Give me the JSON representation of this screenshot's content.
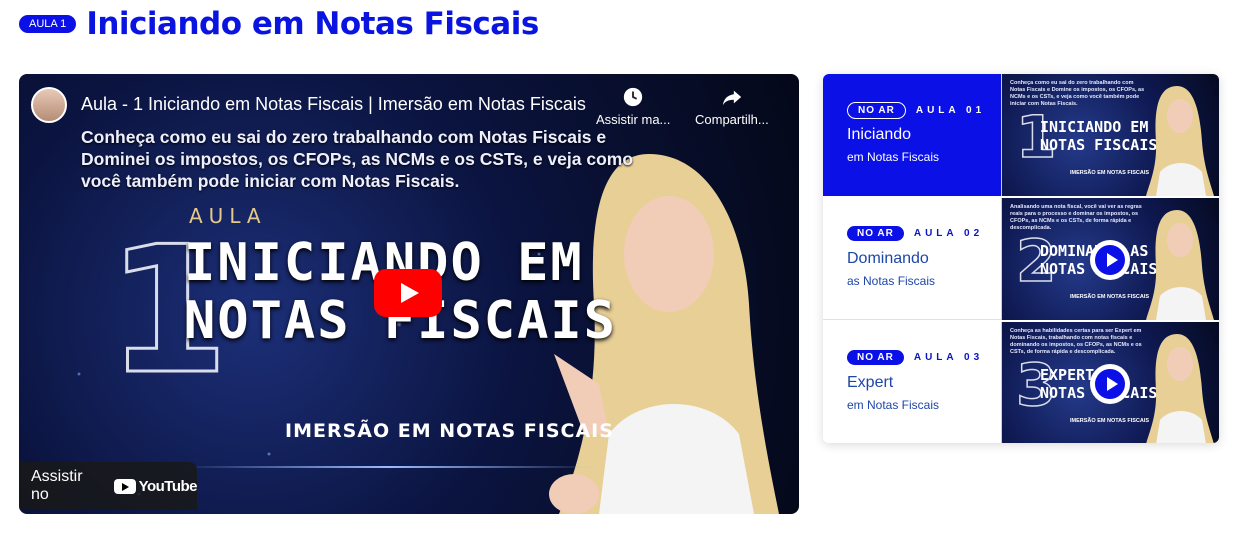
{
  "header": {
    "badge": "AULA 1",
    "title": "Iniciando em Notas Fiscais"
  },
  "player": {
    "video_title": "Aula - 1 Iniciando em Notas Fiscais | Imersão em Notas Fiscais",
    "watch_later_label": "Assistir ma...",
    "share_label": "Compartilh...",
    "description": "Conheça como eu sai do zero trabalhando com Notas Fiscais e Dominei os impostos, os CFOPs, as NCMs e os CSTs, e veja como você também pode iniciar com Notas Fiscais.",
    "thumb_number": "1",
    "thumb_aula": "AULA",
    "thumb_title_line1": "INICIANDO EM",
    "thumb_title_line2": "NOTAS FISCAIS",
    "thumb_footer": "IMERSÃO EM NOTAS FISCAIS",
    "watch_on": "Assistir no",
    "youtube": "YouTube"
  },
  "playlist": [
    {
      "tag": "NO AR",
      "aula": "AULA 01",
      "title": "Iniciando",
      "subtitle": "em Notas Fiscais",
      "thumb_desc": "Conheça como eu sai do zero trabalhando com Notas Fiscais e Domine os impostos, os CFOPs, as NCMs e os CSTs, e veja como você também pode iniciar com Notas Fiscais.",
      "thumb_number": "1",
      "thumb_line1": "INICIANDO EM",
      "thumb_line2": "NOTAS FISCAIS",
      "thumb_footer": "IMERSÃO EM NOTAS FISCAIS"
    },
    {
      "tag": "NO AR",
      "aula": "AULA 02",
      "title": "Dominando",
      "subtitle": "as Notas Fiscais",
      "thumb_desc": "Analisando uma nota fiscal, você vai ver as regras reais para o processo e dominar os impostos, os CFOPs, as NCMs e os CSTs, de forma rápida e descomplicada.",
      "thumb_number": "2",
      "thumb_line1": "DOMINANDO AS",
      "thumb_line2": "NOTAS FISCAIS",
      "thumb_footer": "IMERSÃO EM NOTAS FISCAIS"
    },
    {
      "tag": "NO AR",
      "aula": "AULA 03",
      "title": "Expert",
      "subtitle": "em Notas Fiscais",
      "thumb_desc": "Conheça as habilidades certas para ser Expert em Notas Fiscais, trabalhando com notas fiscais e dominando os impostos, os CFOPs, as NCMs e os CSTs, de forma rápida e descomplicada.",
      "thumb_number": "3",
      "thumb_line1": "EXPERT EM",
      "thumb_line2": "NOTAS FISCAIS",
      "thumb_footer": "IMERSÃO EM NOTAS FISCAIS"
    }
  ]
}
